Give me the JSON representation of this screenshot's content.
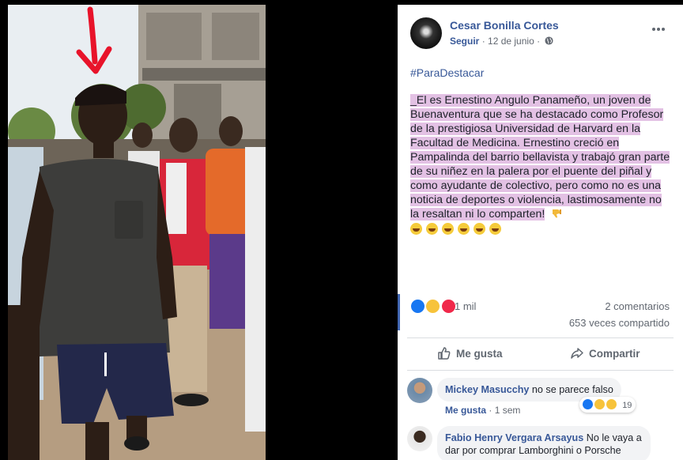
{
  "post": {
    "author": "Cesar Bonilla Cortes",
    "follow": "Seguir",
    "separator": "·",
    "date": "12 de junio",
    "separator2": "·",
    "hashtag": "#ParaDestacar",
    "body": "_El es Ernestino Angulo Panameño, un joven de Buenaventura que se ha destacado como Profesor de la prestigiosa Universidad de Harvard en la Facultad de Medicina. Ernestino creció en Pampalinda del barrio bellavista y trabajó gran parte de su niñez en la palera por el puente del piñal y como ayudante de colectivo, pero como no es una noticia de deportes o violencia, lastimosamente no la resaltan ni lo comparten!",
    "trailing_icon": "thumbs-down-emoji",
    "emoji_row": [
      "laughing-emoji",
      "laughing-emoji",
      "laughing-emoji",
      "laughing-emoji",
      "laughing-emoji",
      "laughing-emoji"
    ],
    "highlight_color": "#e3c1e4"
  },
  "stats": {
    "reaction_icons": [
      "like-reaction",
      "haha-reaction",
      "love-reaction"
    ],
    "reactions": "1 mil",
    "comments": "2 comentarios",
    "shares": "653 veces compartido"
  },
  "actions": {
    "like": "Me gusta",
    "share": "Compartir"
  },
  "comments": [
    {
      "name": "Mickey Masucchy",
      "text": "no se parece falso",
      "like_label": "Me gusta",
      "separator": "·",
      "time": "1 sem",
      "reaction_icons": [
        "like-reaction",
        "haha-reaction",
        "wow-reaction"
      ],
      "reaction_count": "19"
    },
    {
      "name": "Fabio Henry Vergara Arsayus",
      "text": "No le vaya a dar por comprar Lamborghini o Porsche"
    }
  ],
  "colors": {
    "link": "#385898",
    "background": "#000000",
    "panel": "#ffffff",
    "arrow": "#e8132a"
  }
}
